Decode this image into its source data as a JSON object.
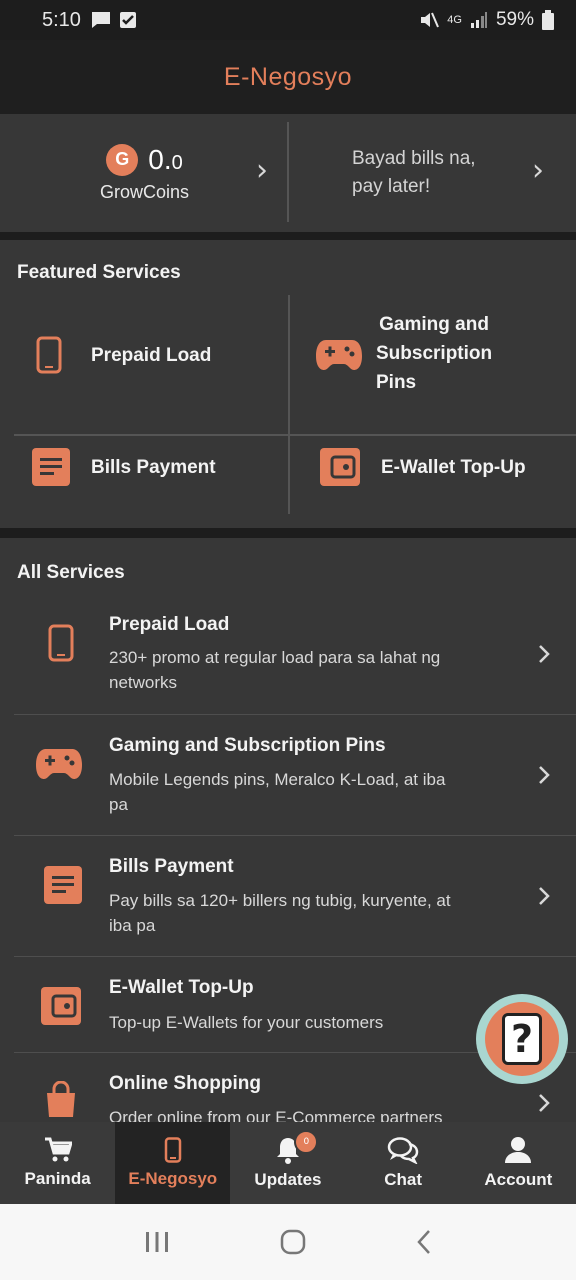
{
  "status_bar": {
    "time": "5:10",
    "network": "4G",
    "battery": "59%",
    "icons": [
      "message-icon",
      "check-icon",
      "mute-icon",
      "signal-icon",
      "battery-icon"
    ]
  },
  "header": {
    "title": "E-Negosyo"
  },
  "growcoins": {
    "badge": "G",
    "value_main": "0.",
    "value_decimal": "0",
    "label": "GrowCoins"
  },
  "promo": {
    "line1": "Bayad bills na,",
    "line2": "pay later!"
  },
  "featured": {
    "title": "Featured Services",
    "items": [
      {
        "label": "Prepaid Load",
        "icon": "phone-icon"
      },
      {
        "label_lines": [
          "Gaming and",
          "Subscription",
          "Pins"
        ],
        "icon": "gamepad-icon"
      },
      {
        "label": "Bills Payment",
        "icon": "document-icon"
      },
      {
        "label": "E-Wallet Top-Up",
        "icon": "wallet-icon"
      }
    ]
  },
  "all_services": {
    "title": "All Services",
    "items": [
      {
        "title": "Prepaid Load",
        "desc_lines": [
          "230+ promo at regular load para sa lahat ng",
          "networks"
        ],
        "icon": "phone-icon"
      },
      {
        "title": "Gaming and Subscription Pins",
        "desc_lines": [
          "Mobile Legends pins, Meralco K-Load, at iba",
          "pa"
        ],
        "icon": "gamepad-icon"
      },
      {
        "title": "Bills Payment",
        "desc_lines": [
          "Pay bills sa 120+ billers ng tubig, kuryente, at",
          "iba pa"
        ],
        "icon": "document-icon"
      },
      {
        "title": "E-Wallet Top-Up",
        "desc_lines": [
          "Top-up E-Wallets for your customers"
        ],
        "icon": "wallet-icon"
      },
      {
        "title": "Online Shopping",
        "desc_lines": [
          "Order online from our E-Commerce partners"
        ],
        "icon": "shopping-bag-icon"
      }
    ]
  },
  "bottom_nav": {
    "items": [
      {
        "label": "Paninda",
        "icon": "cart-icon"
      },
      {
        "label": "E-Negosyo",
        "icon": "phone-icon",
        "active": true
      },
      {
        "label": "Updates",
        "icon": "bell-icon",
        "badge": "0"
      },
      {
        "label": "Chat",
        "icon": "chat-icon"
      },
      {
        "label": "Account",
        "icon": "user-icon"
      }
    ]
  },
  "colors": {
    "accent": "#e37f5b",
    "panel": "#373737",
    "background": "#1d1d1d",
    "fab_ring": "#a9d6d0"
  }
}
